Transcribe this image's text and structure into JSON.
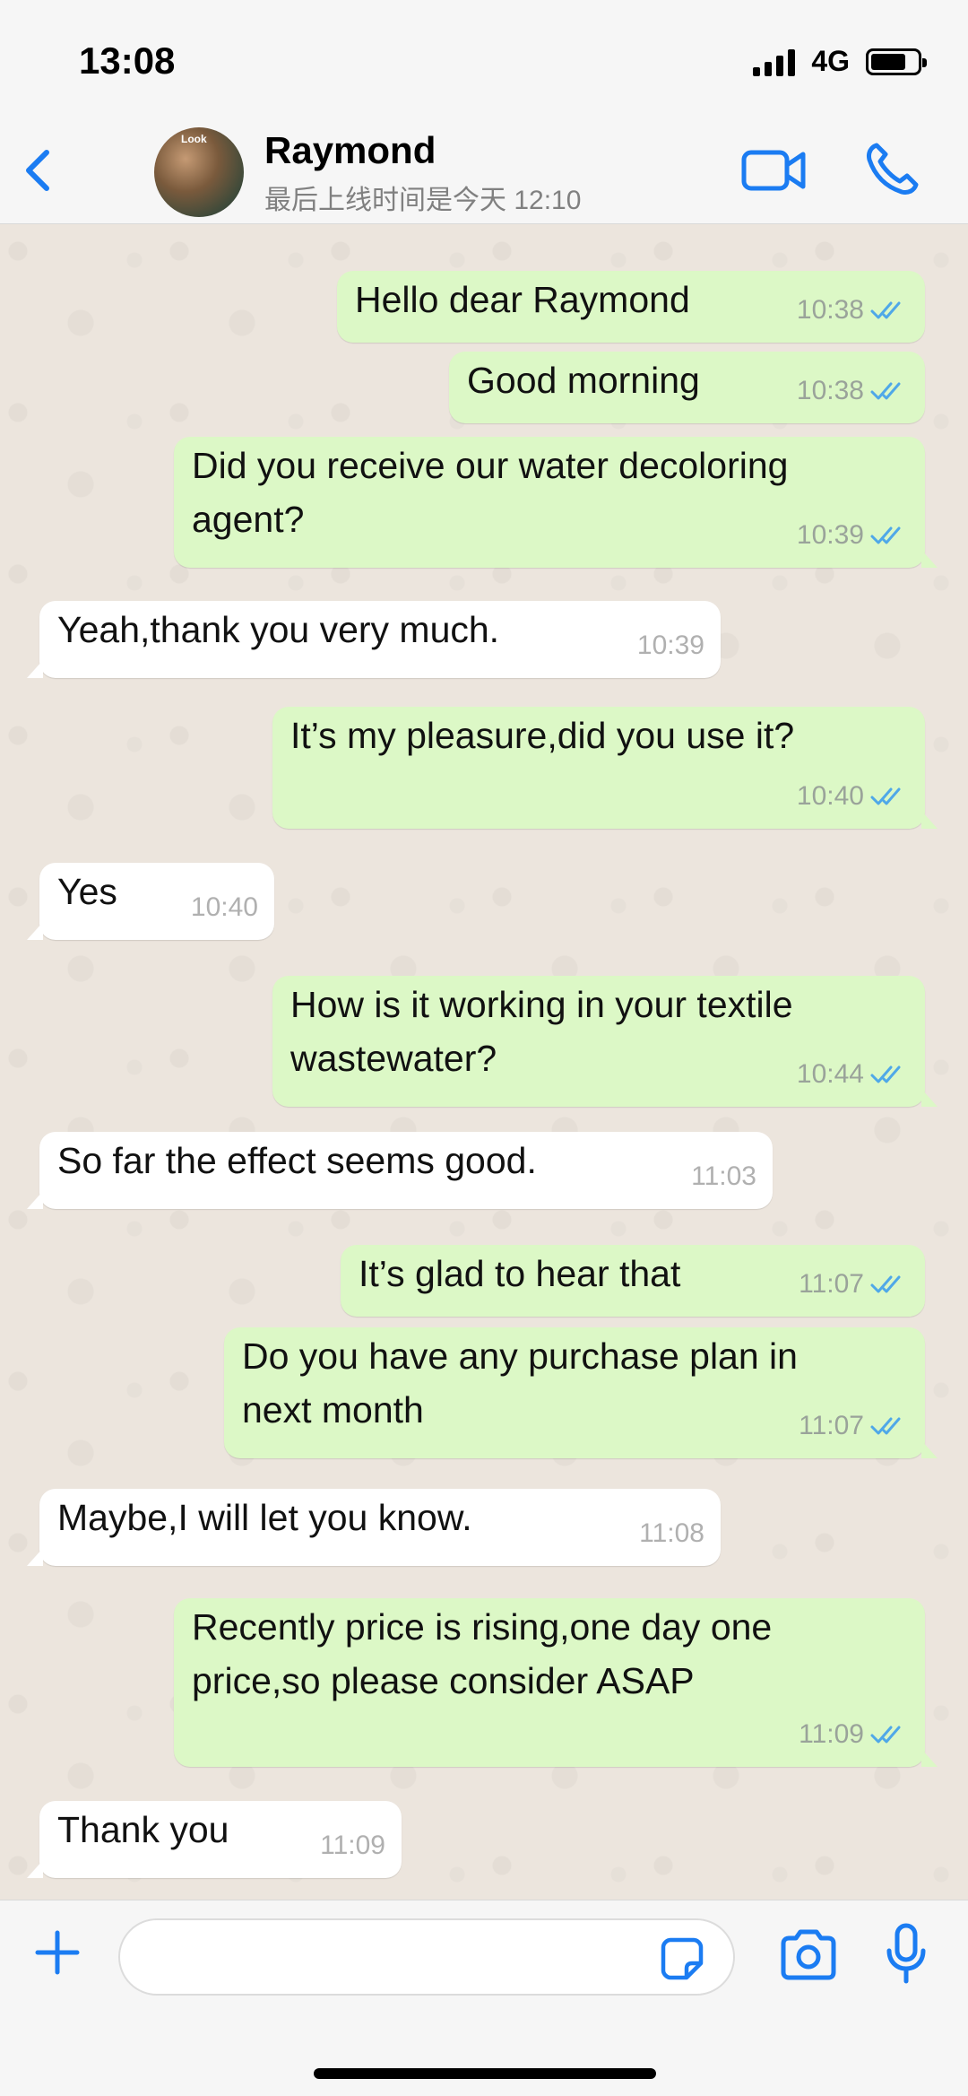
{
  "status_bar": {
    "time": "13:08",
    "network": "4G"
  },
  "header": {
    "contact_name": "Raymond",
    "last_seen": "最后上线时间是今天 12:10",
    "avatar_tag": "Look"
  },
  "colors": {
    "accent": "#1b7cf2",
    "outgoing_bubble": "#dcf8c6",
    "incoming_bubble": "#ffffff",
    "read_tick": "#4fa8e8",
    "chat_background": "#ece5dd"
  },
  "messages": [
    {
      "dir": "out",
      "text": "Hello dear Raymond",
      "time": "10:38",
      "status": "read"
    },
    {
      "dir": "out",
      "text": "Good morning",
      "time": "10:38",
      "status": "read"
    },
    {
      "dir": "out",
      "lines": [
        "Did you receive our water decoloring",
        "agent?"
      ],
      "time": "10:39",
      "status": "read"
    },
    {
      "dir": "in",
      "text": "Yeah,thank you very much.",
      "time": "10:39"
    },
    {
      "dir": "out",
      "text": "It’s my pleasure,did you use it?",
      "time": "10:40",
      "status": "read"
    },
    {
      "dir": "in",
      "text": "Yes",
      "time": "10:40"
    },
    {
      "dir": "out",
      "lines": [
        "How is it working in your textile",
        "wastewater?"
      ],
      "time": "10:44",
      "status": "read"
    },
    {
      "dir": "in",
      "text": "So far the effect seems good.",
      "time": "11:03"
    },
    {
      "dir": "out",
      "text": "It’s glad to hear that",
      "time": "11:07",
      "status": "read"
    },
    {
      "dir": "out",
      "lines": [
        "Do you have any purchase plan in",
        "next month"
      ],
      "time": "11:07",
      "status": "read"
    },
    {
      "dir": "in",
      "text": "Maybe,I will let you know.",
      "time": "11:08"
    },
    {
      "dir": "out",
      "lines": [
        "Recently price is rising,one day one",
        "price,so please consider ASAP"
      ],
      "time": "11:09",
      "status": "read"
    },
    {
      "dir": "in",
      "text": "Thank you",
      "time": "11:09"
    }
  ],
  "input_bar": {
    "placeholder": "",
    "value": ""
  },
  "icons": {
    "back": "chevron-left-icon",
    "video": "video-camera-icon",
    "call": "phone-icon",
    "attach": "plus-icon",
    "sticker": "sticker-icon",
    "camera": "camera-icon",
    "mic": "microphone-icon"
  }
}
